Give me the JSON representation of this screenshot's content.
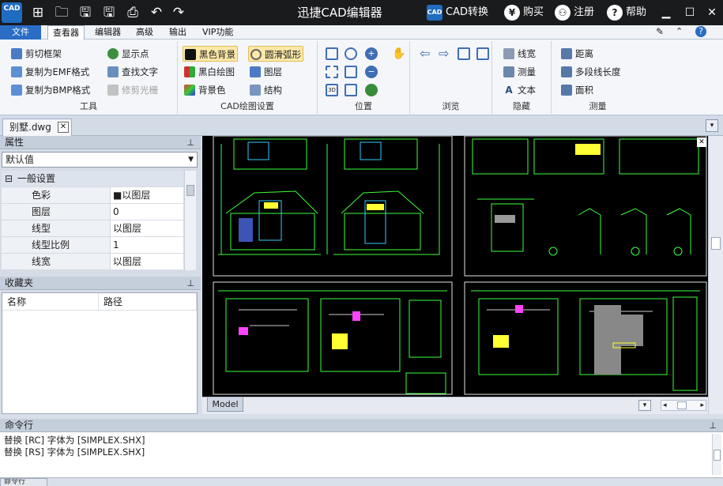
{
  "titlebar": {
    "app_title": "迅捷CAD编辑器",
    "logo_text": "CAD",
    "quick_access": [
      "new-icon",
      "open-icon",
      "save-icon",
      "save-as-icon",
      "print-icon",
      "undo-icon",
      "redo-icon"
    ],
    "buttons": {
      "cad_convert": "CAD转换",
      "buy": "购买",
      "register": "注册",
      "help": "帮助"
    },
    "buy_glyph": "¥",
    "register_glyph": "⚇",
    "help_glyph": "?"
  },
  "menu": {
    "tabs": [
      {
        "label": "文件"
      },
      {
        "label": "查看器"
      },
      {
        "label": "编辑器"
      },
      {
        "label": "高级"
      },
      {
        "label": "输出"
      },
      {
        "label": "VIP功能"
      }
    ]
  },
  "ribbon": {
    "tools": {
      "label": "工具",
      "items": [
        "剪切框架",
        "复制为EMF格式",
        "复制为BMP格式",
        "显示点",
        "查找文字",
        "修剪光栅"
      ]
    },
    "cad_settings": {
      "label": "CAD绘图设置",
      "items": [
        "黑色背景",
        "黑白绘图",
        "背景色",
        "圆滑弧形",
        "图层",
        "结构"
      ]
    },
    "position": {
      "label": "位置"
    },
    "browse": {
      "label": "浏览"
    },
    "hide": {
      "label": "隐藏",
      "items": [
        "线宽",
        "测量",
        "文本"
      ]
    },
    "measure": {
      "label": "测量",
      "items": [
        "距离",
        "多段线长度",
        "面积"
      ]
    }
  },
  "document": {
    "tab_label": "别墅.dwg",
    "model_tab": "Model"
  },
  "properties": {
    "title": "属性",
    "selector_value": "默认值",
    "group_label": "一般设置",
    "group_toggle": "⊟",
    "rows": [
      {
        "key": "色彩",
        "value": "■以图层"
      },
      {
        "key": "图层",
        "value": "0"
      },
      {
        "key": "线型",
        "value": "以图层"
      },
      {
        "key": "线型比例",
        "value": "1"
      },
      {
        "key": "线宽",
        "value": "以图层"
      }
    ]
  },
  "favorites": {
    "title": "收藏夹",
    "columns": [
      "名称",
      "路径"
    ]
  },
  "command": {
    "title": "命令行",
    "lines": [
      "替换 [RC] 字体为 [SIMPLEX.SHX]",
      "替换 [RS] 字体为 [SIMPLEX.SHX]"
    ],
    "tab_label": "命令行"
  },
  "colors": {
    "titlebar": "#1a1b1d",
    "accent": "#2b6cc4",
    "cad_green": "#3cff3c",
    "cad_yellow": "#ffff33",
    "cad_magenta": "#ff44ff"
  }
}
